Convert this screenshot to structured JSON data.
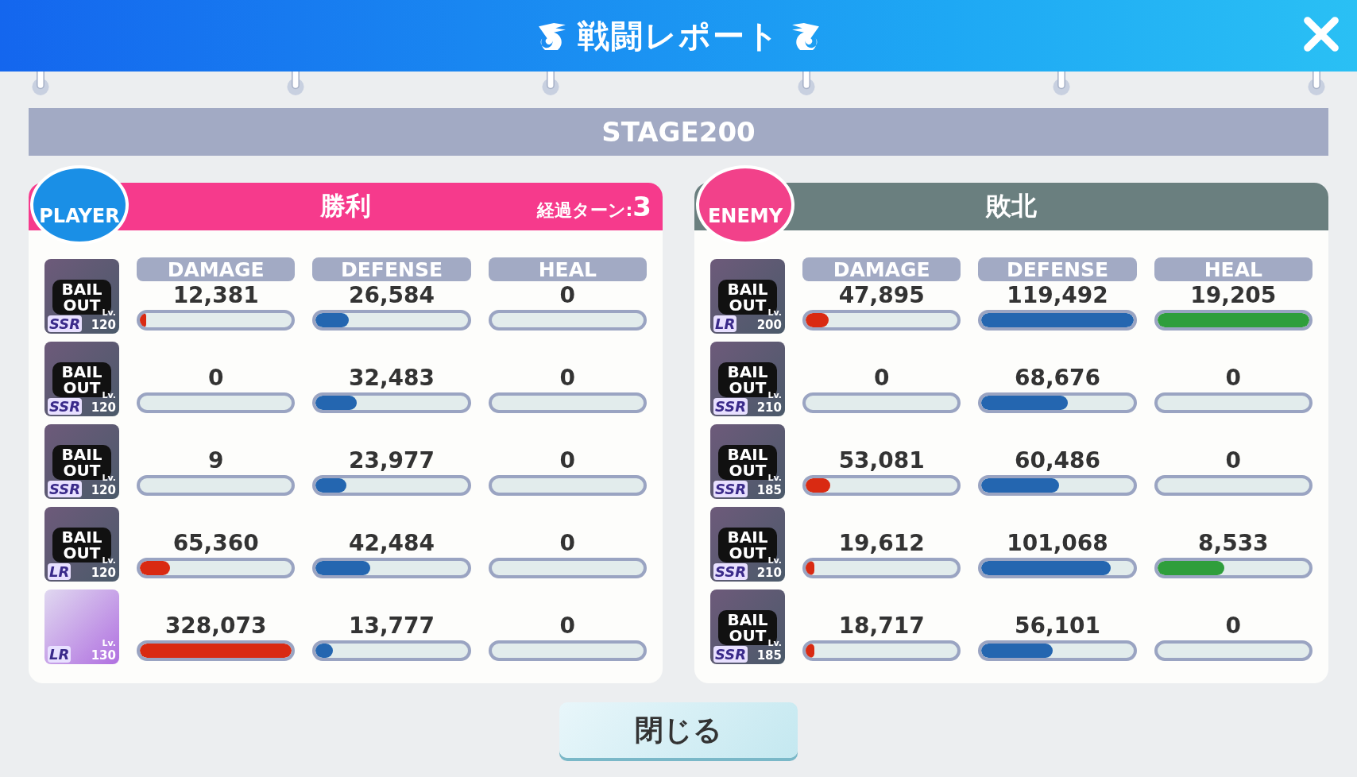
{
  "header": {
    "title": "戦闘レポート"
  },
  "stage": "STAGE200",
  "teams": [
    {
      "kind": "player",
      "badge": "PLAYER",
      "result": "勝利",
      "turns_label": "経過ターン:",
      "turns": "3",
      "columns": [
        {
          "label": "DAMAGE",
          "kind": "damage"
        },
        {
          "label": "DEFENSE",
          "kind": "defense"
        },
        {
          "label": "HEAL",
          "kind": "heal"
        }
      ],
      "units": [
        {
          "status": "BAIL OUT",
          "rarity": "SSR",
          "lv": "Lv.",
          "level_text": "120",
          "stats": [
            {
              "value": "12,381",
              "level": 0.04
            },
            {
              "value": "26,584",
              "level": 0.22
            },
            {
              "value": "0",
              "level": 0
            }
          ]
        },
        {
          "status": "BAIL OUT",
          "rarity": "SSR",
          "lv": "Lv.",
          "level_text": "120",
          "stats": [
            {
              "value": "0",
              "level": 0
            },
            {
              "value": "32,483",
              "level": 0.27
            },
            {
              "value": "0",
              "level": 0
            }
          ]
        },
        {
          "status": "BAIL OUT",
          "rarity": "SSR",
          "lv": "Lv.",
          "level_text": "120",
          "stats": [
            {
              "value": "9",
              "level": 0
            },
            {
              "value": "23,977",
              "level": 0.2
            },
            {
              "value": "0",
              "level": 0
            }
          ]
        },
        {
          "status": "BAIL OUT",
          "rarity": "LR",
          "lv": "Lv.",
          "level_text": "120",
          "stats": [
            {
              "value": "65,360",
              "level": 0.2
            },
            {
              "value": "42,484",
              "level": 0.36
            },
            {
              "value": "0",
              "level": 0
            }
          ]
        },
        {
          "rarity": "LR",
          "lv": "Lv.",
          "level_text": "130",
          "stats": [
            {
              "value": "328,073",
              "level": 1
            },
            {
              "value": "13,777",
              "level": 0.115
            },
            {
              "value": "0",
              "level": 0
            }
          ]
        }
      ]
    },
    {
      "kind": "enemy",
      "badge": "ENEMY",
      "result": "敗北",
      "columns": [
        {
          "label": "DAMAGE",
          "kind": "damage"
        },
        {
          "label": "DEFENSE",
          "kind": "defense"
        },
        {
          "label": "HEAL",
          "kind": "heal"
        }
      ],
      "units": [
        {
          "status": "BAIL OUT",
          "rarity": "LR",
          "lv": "Lv.",
          "level_text": "200",
          "stats": [
            {
              "value": "47,895",
              "level": 0.15
            },
            {
              "value": "119,492",
              "level": 1
            },
            {
              "value": "19,205",
              "level": 1
            }
          ]
        },
        {
          "status": "BAIL OUT",
          "rarity": "SSR",
          "lv": "Lv.",
          "level_text": "210",
          "stats": [
            {
              "value": "0",
              "level": 0
            },
            {
              "value": "68,676",
              "level": 0.57
            },
            {
              "value": "0",
              "level": 0
            }
          ]
        },
        {
          "status": "BAIL OUT",
          "rarity": "SSR",
          "lv": "Lv.",
          "level_text": "185",
          "stats": [
            {
              "value": "53,081",
              "level": 0.16
            },
            {
              "value": "60,486",
              "level": 0.51
            },
            {
              "value": "0",
              "level": 0
            }
          ]
        },
        {
          "status": "BAIL OUT",
          "rarity": "SSR",
          "lv": "Lv.",
          "level_text": "210",
          "stats": [
            {
              "value": "19,612",
              "level": 0.06
            },
            {
              "value": "101,068",
              "level": 0.85
            },
            {
              "value": "8,533",
              "level": 0.44
            }
          ]
        },
        {
          "status": "BAIL OUT",
          "rarity": "SSR",
          "lv": "Lv.",
          "level_text": "185",
          "stats": [
            {
              "value": "18,717",
              "level": 0.057
            },
            {
              "value": "56,101",
              "level": 0.47
            },
            {
              "value": "0",
              "level": 0
            }
          ]
        }
      ]
    }
  ],
  "close_button": "閉じる"
}
